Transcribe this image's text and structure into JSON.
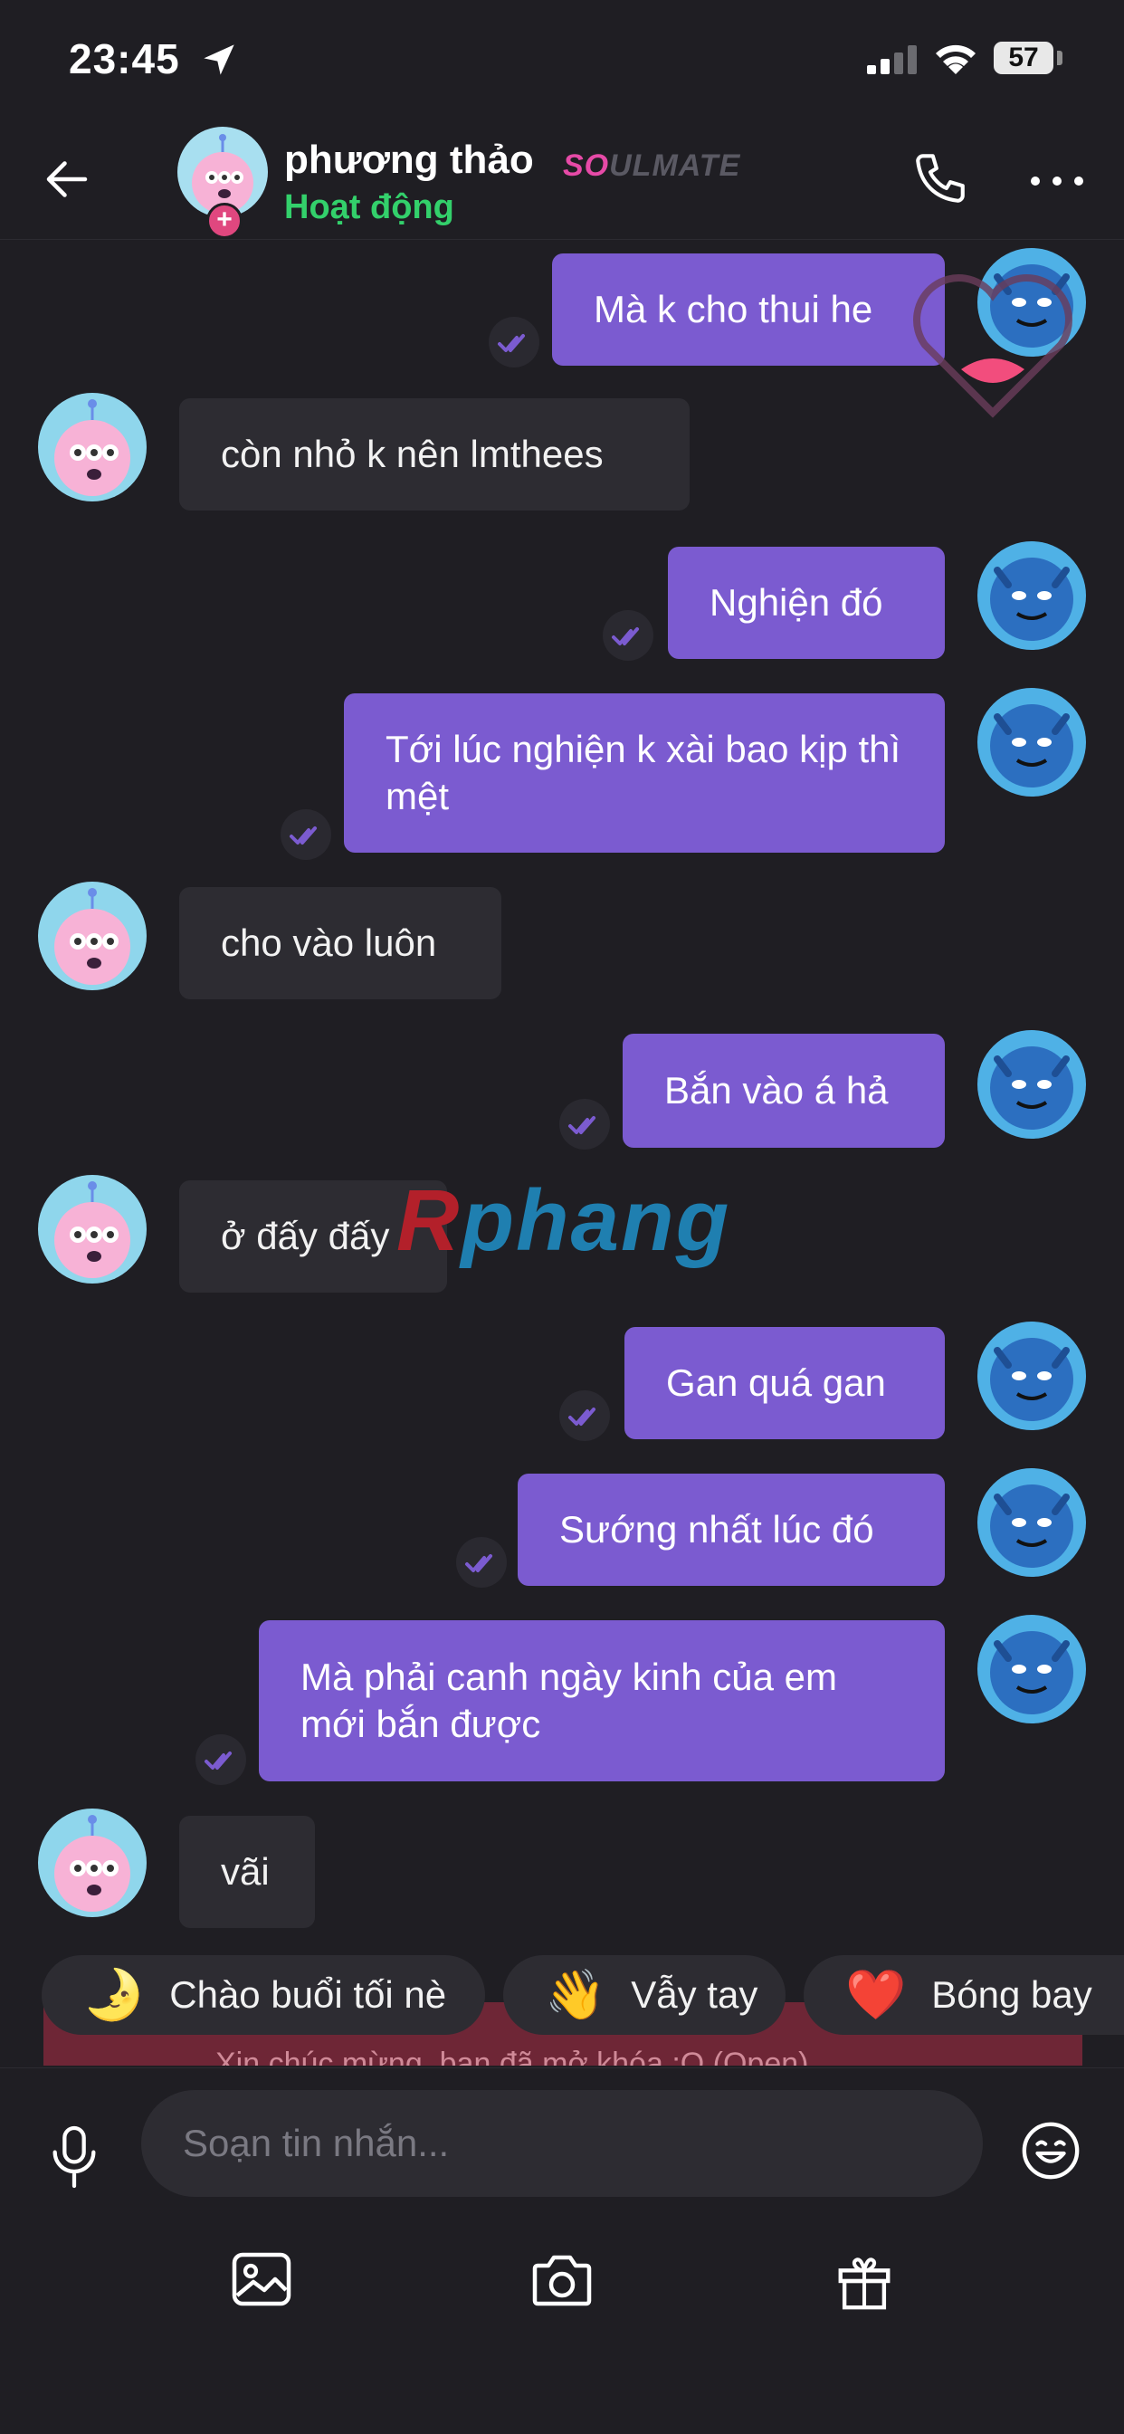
{
  "status_bar": {
    "time": "23:45",
    "battery": "57"
  },
  "header": {
    "contact_name": "phương thảo",
    "badge_so": "SO",
    "badge_rest": "ULMATE",
    "presence": "Hoạt động"
  },
  "messages": [
    {
      "side": "out",
      "text": "Mà k cho thui he"
    },
    {
      "side": "in",
      "text": "còn nhỏ k nên lmthees"
    },
    {
      "side": "out",
      "text": "Nghiện đó"
    },
    {
      "side": "out",
      "text": "Tới lúc nghiện k xài bao kịp thì mệt"
    },
    {
      "side": "in",
      "text": "cho vào luôn"
    },
    {
      "side": "out",
      "text": "Bắn vào á hả"
    },
    {
      "side": "in",
      "text": "ở đấy đấy"
    },
    {
      "side": "out",
      "text": "Gan quá gan"
    },
    {
      "side": "out",
      "text": "Sướng nhất lúc đó"
    },
    {
      "side": "out",
      "text": "Mà phải canh ngày kinh của em mới bắn được"
    },
    {
      "side": "in",
      "text": "vãi"
    }
  ],
  "watermark": {
    "part1": "R",
    "part2": "phang"
  },
  "notice_text": "Xin chúc mừng, bạn đã mở khóa :O (Open).",
  "quick_replies": [
    {
      "emoji": "🌛",
      "label": "Chào buổi tối nè"
    },
    {
      "emoji": "👋",
      "label": "Vẫy tay"
    },
    {
      "emoji": "❤️",
      "label": "Bóng bay"
    }
  ],
  "composer": {
    "placeholder": "Soạn tin nhắn..."
  },
  "colors": {
    "outgoing": "#7b5bd0",
    "incoming": "#2d2c32",
    "presence": "#33d06b",
    "background": "#1f1e23"
  },
  "icons": [
    "location-arrow-icon",
    "signal-icon",
    "wifi-icon",
    "back-arrow-icon",
    "phone-icon",
    "more-icon",
    "double-check-icon",
    "microphone-icon",
    "emoji-icon",
    "gallery-icon",
    "camera-icon",
    "gift-icon"
  ]
}
